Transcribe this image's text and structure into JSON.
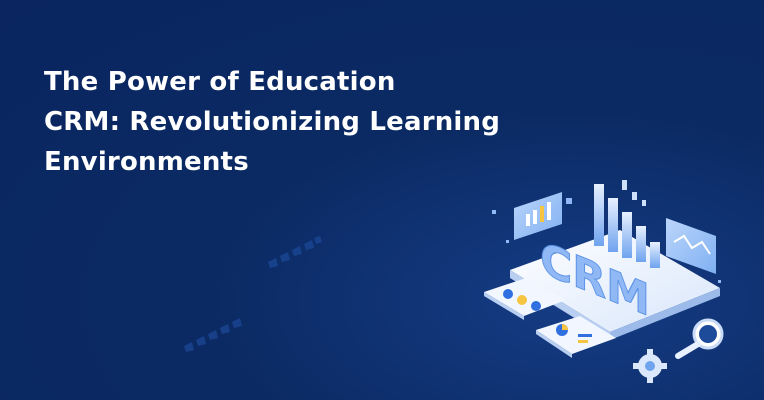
{
  "banner": {
    "headline_lines": [
      "The Power of Education",
      "CRM: Revolutionizing Learning",
      "Environments"
    ],
    "illustration": {
      "screen_text": "CRM",
      "icons": [
        "bar-chart-icon",
        "line-chart-icon",
        "pie-chart-icon",
        "magnifier-icon",
        "gear-icon"
      ]
    },
    "colors": {
      "background": "#0b2a63",
      "headline": "#ffffff",
      "accent_blue": "#2f6fe0",
      "accent_yellow": "#f5c542",
      "platform": "#eef4ff"
    }
  }
}
